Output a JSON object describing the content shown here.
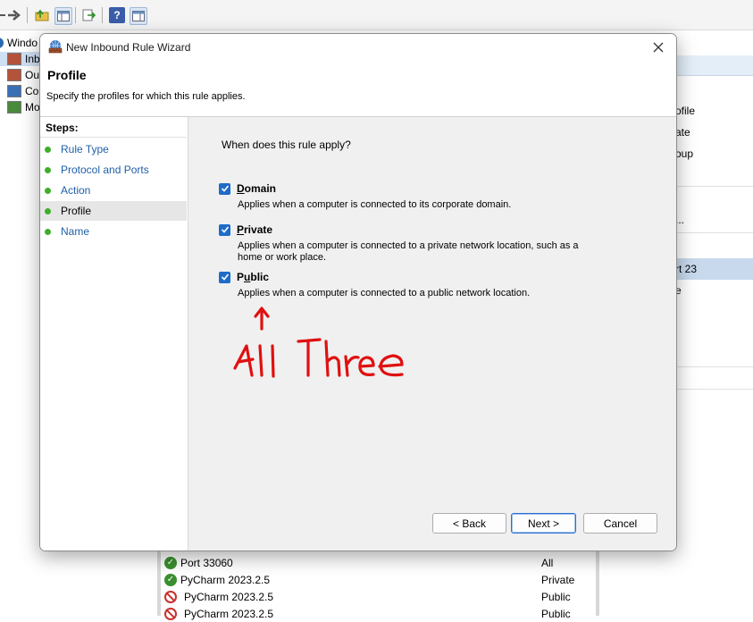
{
  "background": {
    "tree_items": [
      "Windo",
      "Inb",
      "Ou",
      "Co",
      "Mo"
    ],
    "right_panel_items": [
      "ofile",
      "ate",
      "oup",
      "...",
      "rt 23",
      "e"
    ],
    "list_rows": [
      {
        "name": "Port 33060",
        "profile": "All",
        "status": "allow"
      },
      {
        "name": "PyCharm 2023.2.5",
        "profile": "Private",
        "status": "allow"
      },
      {
        "name": "PyCharm 2023.2.5",
        "profile": "Public",
        "status": "block"
      },
      {
        "name": "PyCharm 2023.2.5",
        "profile": "Public",
        "status": "block"
      }
    ]
  },
  "wizard": {
    "title": "New Inbound Rule Wizard",
    "header_title": "Profile",
    "header_subtitle": "Specify the profiles for which this rule applies.",
    "steps_label": "Steps:",
    "steps": [
      "Rule Type",
      "Protocol and Ports",
      "Action",
      "Profile",
      "Name"
    ],
    "active_step": "Profile",
    "question": "When does this rule apply?",
    "options": [
      {
        "label_pre": "",
        "label_u": "D",
        "label_post": "omain",
        "desc": "Applies when a computer is connected to its corporate domain.",
        "checked": true
      },
      {
        "label_pre": "",
        "label_u": "P",
        "label_post": "rivate",
        "desc": "Applies when a computer is connected to a private network location, such as a home or work place.",
        "checked": true
      },
      {
        "label_pre": "P",
        "label_u": "u",
        "label_post": "blic",
        "desc": "Applies when a computer is connected to a public network location.",
        "checked": true
      }
    ],
    "buttons": {
      "back": "< Back",
      "next": "Next >",
      "cancel": "Cancel"
    }
  },
  "annotation": {
    "text": "All Three",
    "color": "#e01010"
  },
  "colors": {
    "accent": "#1f6cc7",
    "step_link": "#1f5fa8",
    "step_done": "#3fae2a"
  }
}
